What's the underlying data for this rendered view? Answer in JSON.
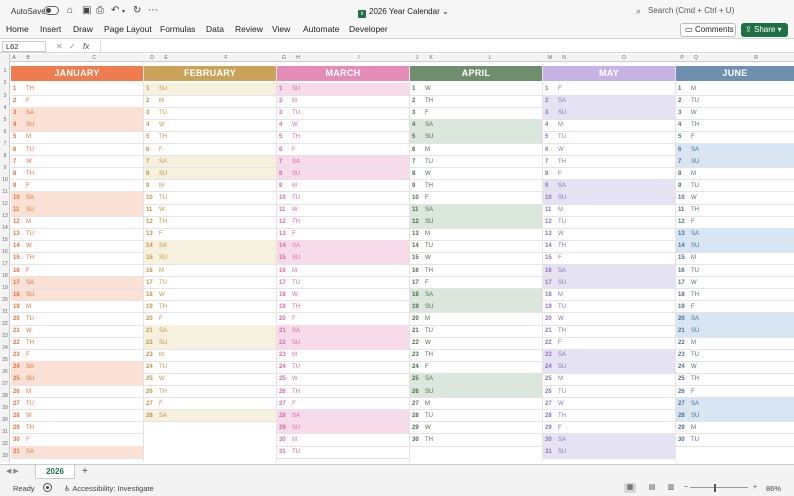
{
  "titlebar": {
    "autosave_label": "AutoSave",
    "doc_title": "2026 Year Calendar",
    "search_placeholder": "Search (Cmd + Ctrl + U)"
  },
  "ribbon": {
    "tabs": [
      "Home",
      "Insert",
      "Draw",
      "Page Layout",
      "Formulas",
      "Data",
      "Review",
      "View",
      "Automate",
      "Developer"
    ],
    "comments_label": "Comments",
    "share_label": "Share"
  },
  "formula_bar": {
    "name_box": "L62",
    "fx_label": "fx",
    "value": ""
  },
  "column_headers": [
    "A",
    "B",
    "C",
    "D",
    "E",
    "F",
    "G",
    "H",
    "I",
    "J",
    "K",
    "L",
    "M",
    "N",
    "O",
    "P",
    "Q",
    "R"
  ],
  "row_headers": [
    "1",
    "2",
    "3",
    "4",
    "5",
    "6",
    "7",
    "8",
    "9",
    "10",
    "11",
    "12",
    "13",
    "14",
    "15",
    "16",
    "17",
    "18",
    "19",
    "20",
    "21",
    "22",
    "23",
    "24",
    "25",
    "26",
    "27",
    "28",
    "29",
    "30",
    "31",
    "32",
    "33"
  ],
  "months": [
    {
      "name": "JANUARY",
      "color": "#ef7c4f",
      "text_color": "#e8703d",
      "tint": "#fbe1d5",
      "first": "TH",
      "days": 31
    },
    {
      "name": "FEBRUARY",
      "color": "#c9a35a",
      "text_color": "#c29546",
      "tint": "#f6f0de",
      "first": "SU",
      "days": 28
    },
    {
      "name": "MARCH",
      "color": "#e48bb8",
      "text_color": "#d76aa3",
      "tint": "#f8dbea",
      "first": "SU",
      "days": 31
    },
    {
      "name": "APRIL",
      "color": "#6f8e6d",
      "text_color": "#4f6e4d",
      "tint": "#dbe6dc",
      "first": "W",
      "days": 30
    },
    {
      "name": "MAY",
      "color": "#c7b3e3",
      "text_color": "#8a75b3",
      "tint": "#e5e2f4",
      "first": "F",
      "days": 31
    },
    {
      "name": "JUNE",
      "color": "#6f8fae",
      "text_color": "#4f6f8e",
      "tint": "#d8e6f3",
      "first": "M",
      "days": 30
    }
  ],
  "weekday_abbr": [
    "M",
    "TU",
    "W",
    "TH",
    "F",
    "SA",
    "SU"
  ],
  "sheet_tabs": [
    "2026"
  ],
  "status": {
    "ready": "Ready",
    "accessibility": "Accessibility: Investigate",
    "zoom": "86%"
  }
}
